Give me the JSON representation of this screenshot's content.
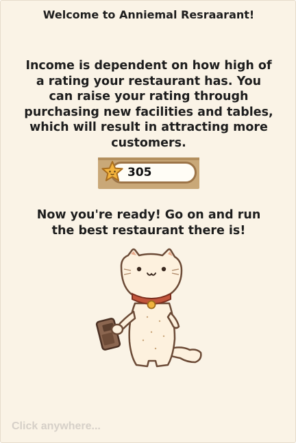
{
  "dialog": {
    "title": "Welcome to Anniemal Resraarant!",
    "body_lines": [
      "Income is dependent on how high of",
      "a rating your restaurant has. You",
      "can raise your rating through",
      "purchasing new facilities and tables,",
      "which will result in attracting more",
      "customers."
    ],
    "rating": {
      "icon": "star-icon",
      "value": "305"
    },
    "ready_lines": [
      "Now you're ready! Go on and run",
      "the best restaurant there is!"
    ],
    "mascot": "cat-holding-phone-illustration",
    "click_hint": "Click anywhere..."
  },
  "colors": {
    "panel_bg": "#faf3e6",
    "text": "#1d1d1d",
    "hint_text": "#d6d0c8",
    "widget_wood": "#c9a878",
    "star": "#f3b33d"
  }
}
